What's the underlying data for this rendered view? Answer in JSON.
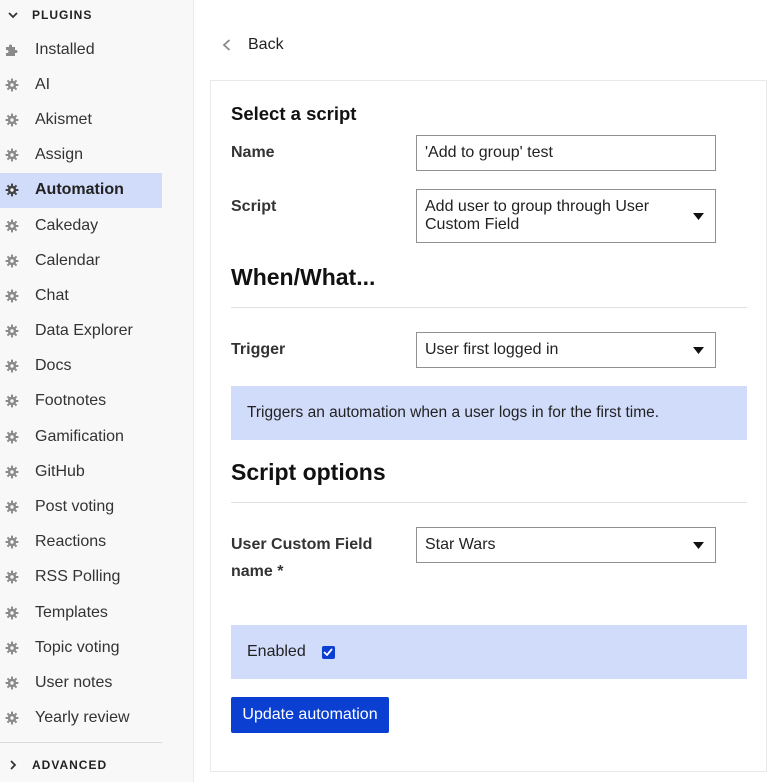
{
  "sidebar": {
    "plugins_header": "PLUGINS",
    "advanced_header": "ADVANCED",
    "items": [
      {
        "label": "Installed",
        "icon": "puzzle-icon"
      },
      {
        "label": "AI",
        "icon": "gear-icon"
      },
      {
        "label": "Akismet",
        "icon": "gear-icon"
      },
      {
        "label": "Assign",
        "icon": "gear-icon"
      },
      {
        "label": "Automation",
        "icon": "gear-icon",
        "active": true
      },
      {
        "label": "Cakeday",
        "icon": "gear-icon"
      },
      {
        "label": "Calendar",
        "icon": "gear-icon"
      },
      {
        "label": "Chat",
        "icon": "gear-icon"
      },
      {
        "label": "Data Explorer",
        "icon": "gear-icon"
      },
      {
        "label": "Docs",
        "icon": "gear-icon"
      },
      {
        "label": "Footnotes",
        "icon": "gear-icon"
      },
      {
        "label": "Gamification",
        "icon": "gear-icon"
      },
      {
        "label": "GitHub",
        "icon": "gear-icon"
      },
      {
        "label": "Post voting",
        "icon": "gear-icon"
      },
      {
        "label": "Reactions",
        "icon": "gear-icon"
      },
      {
        "label": "RSS Polling",
        "icon": "gear-icon"
      },
      {
        "label": "Templates",
        "icon": "gear-icon"
      },
      {
        "label": "Topic voting",
        "icon": "gear-icon"
      },
      {
        "label": "User notes",
        "icon": "gear-icon"
      },
      {
        "label": "Yearly review",
        "icon": "gear-icon"
      }
    ]
  },
  "main": {
    "back_label": "Back",
    "select_script_heading": "Select a script",
    "name_label": "Name",
    "name_value": "'Add to group' test",
    "script_label": "Script",
    "script_value": "Add user to group through User Custom Field",
    "when_what_heading": "When/What...",
    "trigger_label": "Trigger",
    "trigger_value": "User first logged in",
    "trigger_info": "Triggers an automation when a user logs in for the first time.",
    "script_options_heading": "Script options",
    "custom_field_label": "User Custom Field name *",
    "custom_field_value": "Star Wars",
    "enabled_label": "Enabled",
    "enabled_checked": true,
    "update_button": "Update automation"
  },
  "colors": {
    "accent": "#0a3fd1",
    "highlight": "#d1dcfb"
  }
}
